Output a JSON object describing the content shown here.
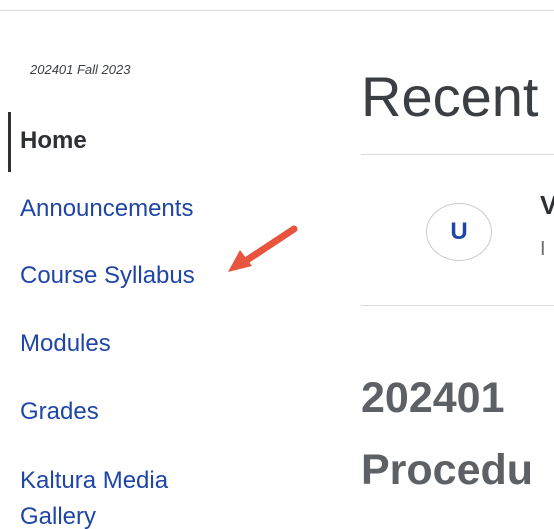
{
  "course": {
    "term": "202401 Fall 2023"
  },
  "nav": {
    "items": [
      {
        "label": "Home",
        "active": true
      },
      {
        "label": "Announcements",
        "active": false
      },
      {
        "label": "Course Syllabus",
        "active": false
      },
      {
        "label": "Modules",
        "active": false
      },
      {
        "label": "Grades",
        "active": false
      },
      {
        "label": "Kaltura Media Gallery",
        "active": false
      }
    ]
  },
  "main": {
    "title": "Recent",
    "activity": {
      "avatar_initial": "U",
      "title_fragment": "V",
      "subtitle_fragment": "I"
    },
    "heading_line1": "202401",
    "heading_line2": "Procedu"
  },
  "annotation": {
    "arrow_color": "#e8553e",
    "points_to": "Course Syllabus"
  }
}
